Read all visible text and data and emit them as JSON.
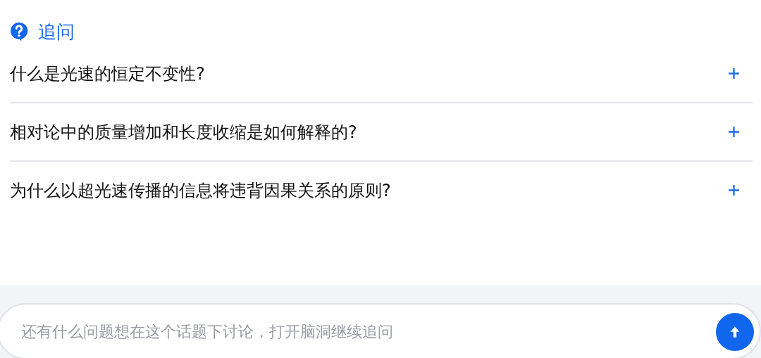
{
  "header": {
    "title": "追问"
  },
  "questions": [
    {
      "text": "什么是光速的恒定不变性?"
    },
    {
      "text": "相对论中的质量增加和长度收缩是如何解释的?"
    },
    {
      "text": "为什么以超光速传播的信息将违背因果关系的原则?"
    }
  ],
  "input": {
    "placeholder": "还有什么问题想在这个话题下讨论，打开脑洞继续追问"
  }
}
